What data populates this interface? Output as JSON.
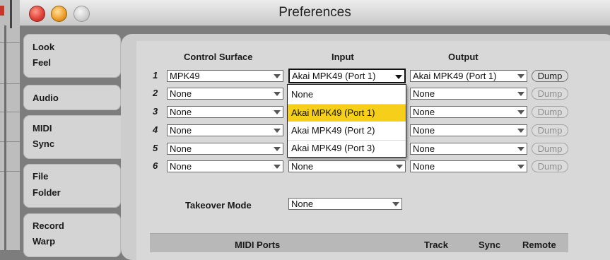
{
  "window": {
    "title": "Preferences"
  },
  "tabs": [
    {
      "line1": "Look",
      "line2": "Feel",
      "active": false
    },
    {
      "line1": "Audio",
      "line2": "",
      "active": false
    },
    {
      "line1": "MIDI",
      "line2": "Sync",
      "active": true
    },
    {
      "line1": "File",
      "line2": "Folder",
      "active": false
    },
    {
      "line1": "Record",
      "line2": "Warp",
      "active": false
    }
  ],
  "midi": {
    "headers": {
      "control_surface": "Control Surface",
      "input": "Input",
      "output": "Output"
    },
    "rows": [
      {
        "num": "1",
        "control_surface": "MPK49",
        "input": "Akai MPK49 (Port 1)",
        "output": "Akai MPK49 (Port 1)",
        "dump": "Dump",
        "dump_enabled": true
      },
      {
        "num": "2",
        "control_surface": "None",
        "input": "None",
        "output": "None",
        "dump": "Dump",
        "dump_enabled": false
      },
      {
        "num": "3",
        "control_surface": "None",
        "input": "None",
        "output": "None",
        "dump": "Dump",
        "dump_enabled": false
      },
      {
        "num": "4",
        "control_surface": "None",
        "input": "None",
        "output": "None",
        "dump": "Dump",
        "dump_enabled": false
      },
      {
        "num": "5",
        "control_surface": "None",
        "input": "None",
        "output": "None",
        "dump": "Dump",
        "dump_enabled": false
      },
      {
        "num": "6",
        "control_surface": "None",
        "input": "None",
        "output": "None",
        "dump": "Dump",
        "dump_enabled": false
      }
    ],
    "input_dropdown": {
      "open": true,
      "options": [
        "None",
        "Akai MPK49 (Port 1)",
        "Akai MPK49 (Port 2)",
        "Akai MPK49 (Port 3)"
      ],
      "highlighted_index": 1,
      "highlight_color": "#f6cf1b"
    },
    "takeover_mode": {
      "label": "Takeover Mode",
      "value": "None"
    },
    "ports_table": {
      "headers": [
        "MIDI Ports",
        "Track",
        "Sync",
        "Remote"
      ]
    }
  }
}
